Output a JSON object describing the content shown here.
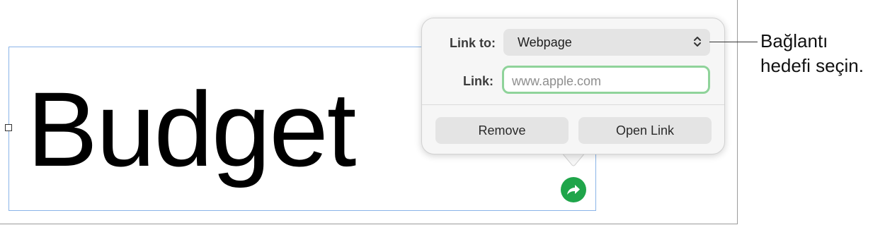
{
  "document": {
    "title_text": "Budget"
  },
  "popover": {
    "link_to_label": "Link to:",
    "link_to_value": "Webpage",
    "link_label": "Link:",
    "link_placeholder": "www.apple.com",
    "remove_button": "Remove",
    "open_link_button": "Open Link"
  },
  "callout": {
    "line1": "Bağlantı",
    "line2": "hedefi seçin."
  },
  "colors": {
    "link_badge": "#1fa54a",
    "input_focus": "#8fd39a",
    "selection": "#8ab4e8"
  }
}
